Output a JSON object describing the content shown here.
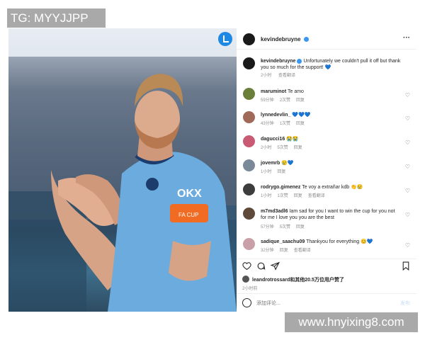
{
  "watermarks": {
    "top": "TG: MYYJJPP",
    "bottom": "www.hnyixing8.com"
  },
  "post": {
    "header_username": "kevindebruyne",
    "more_label": "···",
    "caption_user": "kevindebruyne",
    "caption_text": "Unfortunately we couldn't pull it off but thank you so much for the support! 💙",
    "caption_time": "2小时",
    "caption_translate": "查看翻译"
  },
  "comments": [
    {
      "user": "maruminot",
      "text": "Te amo",
      "time": "59分钟",
      "likes": "2次赞",
      "reply": "回复",
      "extra": "",
      "avatar_color": "#6b7f3a"
    },
    {
      "user": "lynnedevlin_",
      "text": "💙💙💙",
      "time": "43分钟",
      "likes": "1次赞",
      "reply": "回复",
      "extra": "",
      "avatar_color": "#a06a5a"
    },
    {
      "user": "dagucci16",
      "text": "😭😭",
      "time": "2小时",
      "likes": "5次赞",
      "reply": "回复",
      "extra": "",
      "avatar_color": "#c95a73"
    },
    {
      "user": "jovemrb",
      "text": "😢💙",
      "time": "1小时",
      "likes": "",
      "reply": "回复",
      "extra": "",
      "avatar_color": "#7b8a98"
    },
    {
      "user": "rodrygo.gimenez",
      "text": "Te voy a extrañar kdb 👏😢",
      "time": "1小时",
      "likes": "1次赞",
      "reply": "回复",
      "extra": "查看翻译",
      "avatar_color": "#3d3d3d"
    },
    {
      "user": "m7md3adl6",
      "text": "Iam sad for you I want to win the cup for you not for me I love you you are the best",
      "time": "57分钟",
      "likes": "5次赞",
      "reply": "回复",
      "extra": "",
      "avatar_color": "#5d4a3a"
    },
    {
      "user": "sadique_saachu09",
      "text": "Thankyou for everything 😊💙",
      "time": "32分钟",
      "likes": "",
      "reply": "回复",
      "extra": "查看翻译",
      "avatar_color": "#c9a0a8"
    }
  ],
  "likes_line": "leandrotrossard和其他20.5万位用户赞了",
  "post_time": "2小时前",
  "comment_box": {
    "placeholder": "添加评论...",
    "post_label": "发布"
  },
  "player": {
    "sponsor": "OKX",
    "badge": "FA CUP"
  },
  "colors": {
    "jersey": "#6cabdd",
    "armband": "#f26b22",
    "verified": "#3897f0",
    "meta": "#8e8e8e"
  },
  "icons": [
    "heart-icon",
    "comment-icon",
    "share-icon",
    "bookmark-icon",
    "emoji-icon",
    "more-icon",
    "verified-icon"
  ]
}
